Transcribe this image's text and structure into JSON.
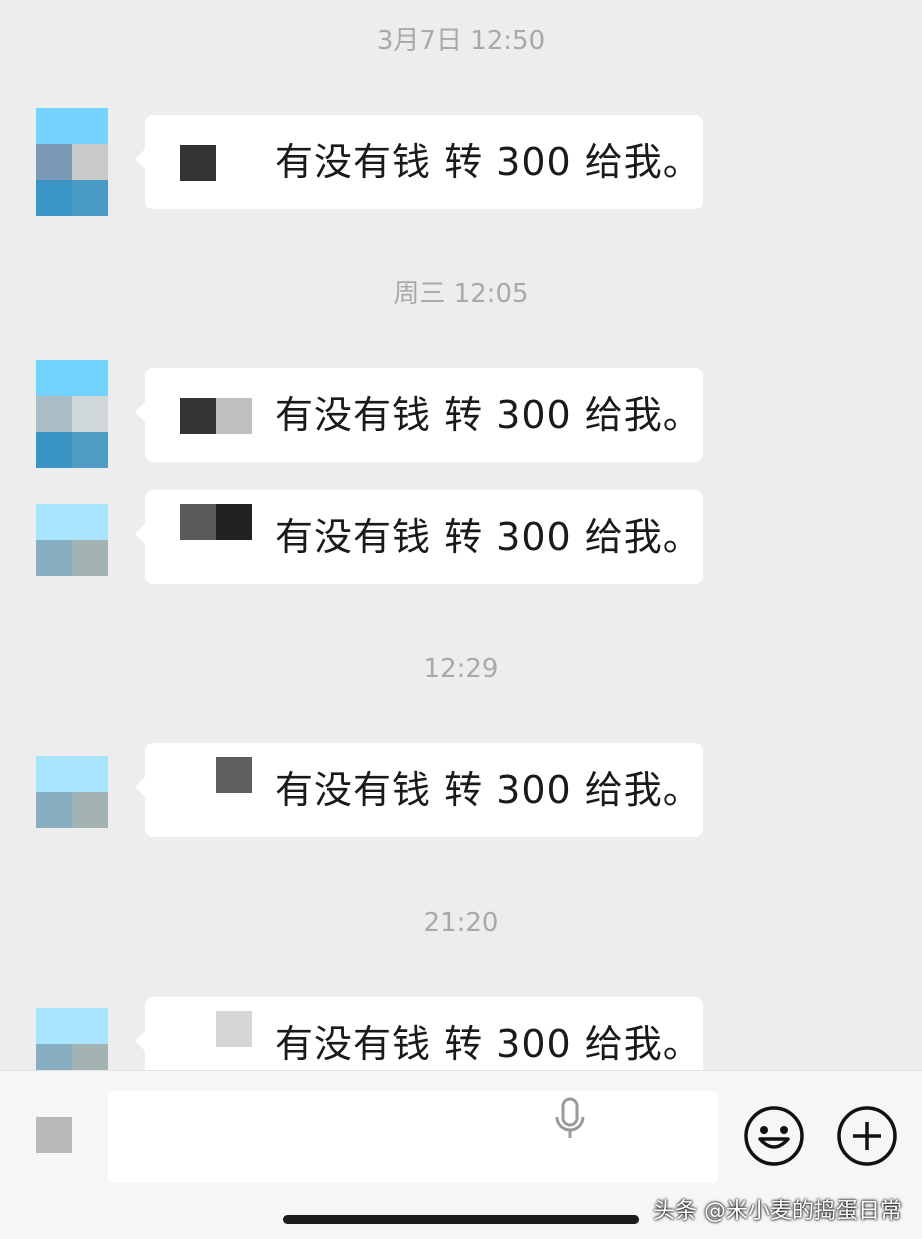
{
  "messages": [
    {
      "time": "3月7日 12:50",
      "text": "有没有钱  转 300 给我。"
    },
    {
      "time": "周三 12:05",
      "text": "有没有钱  转 300 给我。"
    },
    {
      "time": "",
      "text": "有没有钱  转 300 给我。"
    },
    {
      "time": "12:29",
      "text": "有没有钱  转 300 给我。"
    },
    {
      "time": "21:20",
      "text": "有没有钱  转 300 给我。"
    }
  ],
  "input": {
    "value": "",
    "voice_toggle_icon": "voice-toggle-icon",
    "mic_icon": "microphone-icon",
    "emoji_icon": "smiley-icon",
    "more_icon": "plus-circle-icon"
  },
  "watermark": "头条 @米小麦的捣蛋日常",
  "colors": {
    "background": "#ededed",
    "bubble": "#ffffff",
    "timestamp": "#a9a9a9",
    "text": "#1a1a1a"
  }
}
